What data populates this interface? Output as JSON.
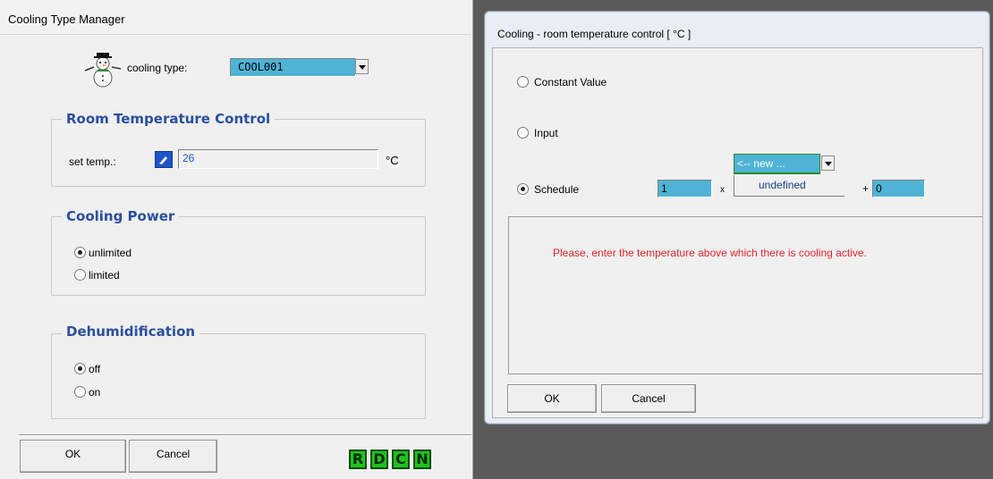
{
  "left_window": {
    "title": "Cooling Type Manager",
    "cooling_type_label": "cooling type:",
    "cooling_type_value": "COOL001",
    "room_temp_group": "Room Temperature Control",
    "set_temp_label": "set temp.:",
    "set_temp_value": "26",
    "unit": "°C",
    "cooling_power_group": "Cooling Power",
    "power_options": [
      "unlimited",
      "limited"
    ],
    "power_selected": "unlimited",
    "dehum_group": "Dehumidification",
    "dehum_options": [
      "off",
      "on"
    ],
    "dehum_selected": "off",
    "ok": "OK",
    "cancel": "Cancel",
    "letter_buttons": [
      "R",
      "D",
      "C",
      "N"
    ]
  },
  "right_window": {
    "title": "Cooling - room temperature control  [ °C ]",
    "options": [
      "Constant Value",
      "Input",
      "Schedule"
    ],
    "selected": "Schedule",
    "factor": "1",
    "times": "x",
    "schedule_dropdown": "<-- new ...",
    "schedule_value": "undefined",
    "plus": "+",
    "offset": "0",
    "hint": "Please, enter the temperature above which there is cooling active.",
    "ok": "OK",
    "cancel": "Cancel"
  },
  "colors": {
    "field_cyan": "#4fb3d6",
    "group_title_blue": "#2a4f9e",
    "hint_red": "#e0252a",
    "letter_green": "#22c022"
  }
}
